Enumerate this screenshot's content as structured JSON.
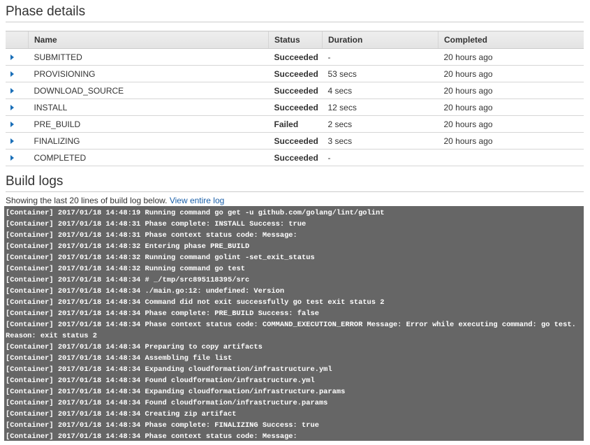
{
  "phase_details": {
    "title": "Phase details",
    "columns": [
      "",
      "Name",
      "Status",
      "Duration",
      "Completed"
    ],
    "rows": [
      {
        "name": "SUBMITTED",
        "status": "Succeeded",
        "status_type": "success",
        "duration": "-",
        "completed": "20 hours ago"
      },
      {
        "name": "PROVISIONING",
        "status": "Succeeded",
        "status_type": "success",
        "duration": "53 secs",
        "completed": "20 hours ago"
      },
      {
        "name": "DOWNLOAD_SOURCE",
        "status": "Succeeded",
        "status_type": "success",
        "duration": "4 secs",
        "completed": "20 hours ago"
      },
      {
        "name": "INSTALL",
        "status": "Succeeded",
        "status_type": "success",
        "duration": "12 secs",
        "completed": "20 hours ago"
      },
      {
        "name": "PRE_BUILD",
        "status": "Failed",
        "status_type": "failure",
        "duration": "2 secs",
        "completed": "20 hours ago"
      },
      {
        "name": "FINALIZING",
        "status": "Succeeded",
        "status_type": "success",
        "duration": "3 secs",
        "completed": "20 hours ago"
      },
      {
        "name": "COMPLETED",
        "status": "Succeeded",
        "status_type": "success",
        "duration": "-",
        "completed": ""
      }
    ]
  },
  "build_logs": {
    "title": "Build logs",
    "intro_text": "Showing the last 20 lines of build log below. ",
    "view_link": "View entire log",
    "lines": [
      "[Container] 2017/01/18 14:48:19 Running command go get -u github.com/golang/lint/golint",
      "[Container] 2017/01/18 14:48:31 Phase complete: INSTALL Success: true",
      "[Container] 2017/01/18 14:48:31 Phase context status code: Message:",
      "[Container] 2017/01/18 14:48:32 Entering phase PRE_BUILD",
      "[Container] 2017/01/18 14:48:32 Running command golint -set_exit_status",
      "[Container] 2017/01/18 14:48:32 Running command go test",
      "[Container] 2017/01/18 14:48:34 # _/tmp/src895118395/src",
      "[Container] 2017/01/18 14:48:34 ./main.go:12: undefined: Version",
      "[Container] 2017/01/18 14:48:34 Command did not exit successfully go test exit status 2",
      "[Container] 2017/01/18 14:48:34 Phase complete: PRE_BUILD Success: false",
      "[Container] 2017/01/18 14:48:34 Phase context status code: COMMAND_EXECUTION_ERROR Message: Error while executing command: go test. Reason: exit status 2",
      "[Container] 2017/01/18 14:48:34 Preparing to copy artifacts",
      "[Container] 2017/01/18 14:48:34 Assembling file list",
      "[Container] 2017/01/18 14:48:34 Expanding cloudformation/infrastructure.yml",
      "[Container] 2017/01/18 14:48:34 Found cloudformation/infrastructure.yml",
      "[Container] 2017/01/18 14:48:34 Expanding cloudformation/infrastructure.params",
      "[Container] 2017/01/18 14:48:34 Found cloudformation/infrastructure.params",
      "[Container] 2017/01/18 14:48:34 Creating zip artifact",
      "[Container] 2017/01/18 14:48:34 Phase complete: FINALIZING Success: true",
      "[Container] 2017/01/18 14:48:34 Phase context status code: Message:"
    ]
  },
  "colors": {
    "success": "#1d8f1d",
    "failure": "#c4001a",
    "link": "#1a5fa8",
    "log_background": "#666666"
  }
}
